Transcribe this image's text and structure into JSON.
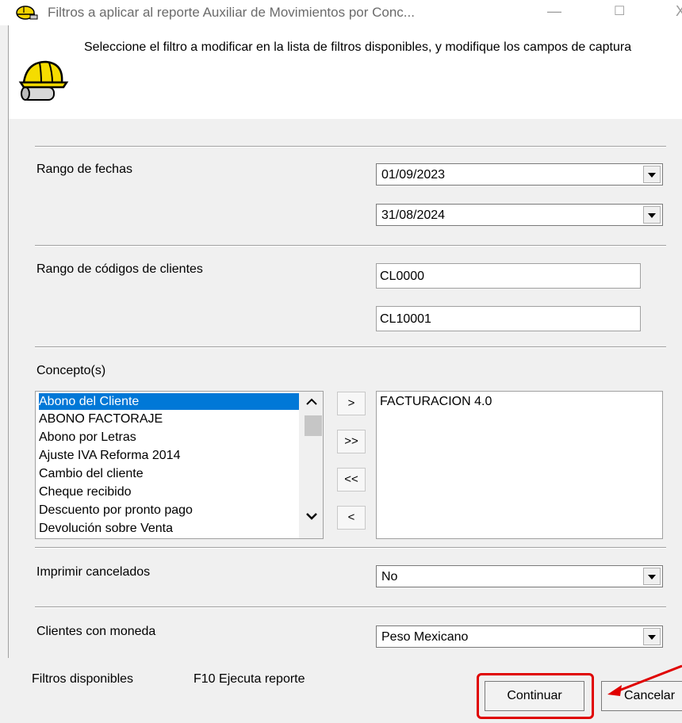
{
  "window": {
    "title": "Filtros a aplicar al reporte Auxiliar de Movimientos por Conc...",
    "minimize_symbol": "—",
    "maximize_symbol": "☐",
    "close_symbol": "X"
  },
  "header": {
    "instruction": "Seleccione el filtro a modificar  en la lista de filtros disponibles, y modifique los campos de  captura",
    "icon": "helmet-and-scroll-icon"
  },
  "filters": {
    "fechas": {
      "label": "Rango de fechas",
      "from": "01/09/2023",
      "to": "31/08/2024"
    },
    "clientes": {
      "label": "Rango de códigos de clientes",
      "from": "CL0000",
      "to": "CL10001"
    },
    "conceptos": {
      "label": "Concepto(s)",
      "available": [
        "Abono del Cliente",
        "ABONO FACTORAJE",
        "Abono por Letras",
        "Ajuste IVA Reforma 2014",
        "Cambio del cliente",
        "Cheque recibido",
        "Descuento por pronto pago",
        "Devolución sobre Venta"
      ],
      "selected_index": 0,
      "chosen": [
        "FACTURACION 4.0"
      ],
      "btn_add": ">",
      "btn_add_all": ">>",
      "btn_remove_all": "<<",
      "btn_remove": "<"
    },
    "cancelados": {
      "label": "Imprimir cancelados",
      "value": "No"
    },
    "moneda": {
      "label": "Clientes con moneda",
      "value": "Peso Mexicano"
    }
  },
  "footer": {
    "filtros_disponibles": "Filtros disponibles",
    "f10_hint": "F10 Ejecuta reporte",
    "continuar": "Continuar",
    "cancelar": "Cancelar"
  },
  "colors": {
    "selection": "#0078d7",
    "highlight": "#e00000"
  }
}
